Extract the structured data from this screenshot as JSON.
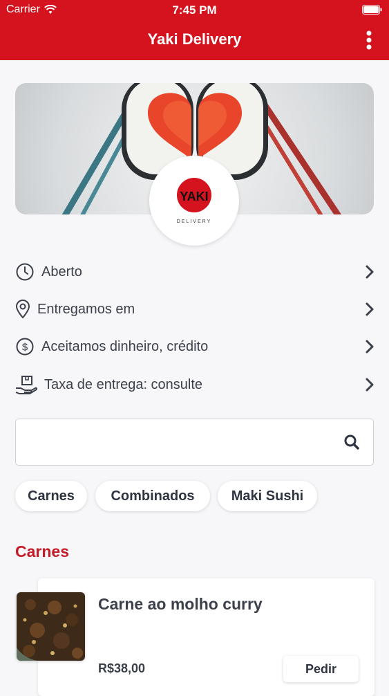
{
  "status_bar": {
    "carrier": "Carrier",
    "time": "7:45 PM"
  },
  "header": {
    "title": "Yaki Delivery",
    "menu_icon": "more-vertical-icon"
  },
  "logo": {
    "brand_text": "YAKI",
    "brand_sub": "DELIVERY"
  },
  "info": [
    {
      "label": "Aberto",
      "icon": "clock-icon"
    },
    {
      "label": "Entregamos em",
      "icon": "location-pin-icon"
    },
    {
      "label": "Aceitamos dinheiro, crédito",
      "icon": "dollar-icon"
    },
    {
      "label": "Taxa de entrega: consulte",
      "icon": "delivery-box-icon"
    }
  ],
  "search": {
    "value": "",
    "placeholder": ""
  },
  "categories": [
    {
      "label": "Carnes"
    },
    {
      "label": "Combinados"
    },
    {
      "label": "Maki Sushi"
    }
  ],
  "section": {
    "title": "Carnes"
  },
  "product": {
    "name": "Carne ao molho curry",
    "price": "R$38,00",
    "button": "Pedir"
  },
  "colors": {
    "brand_red": "#d4131f",
    "section_red": "#c51a28",
    "text": "#3b404a"
  }
}
